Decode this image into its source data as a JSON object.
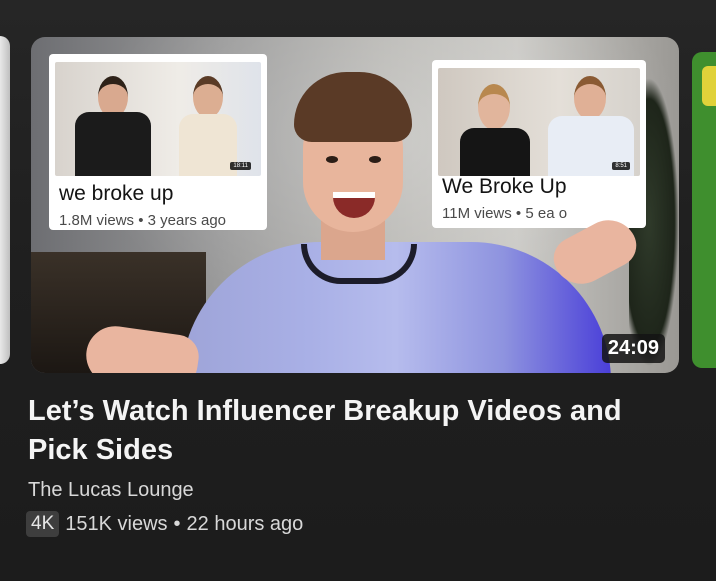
{
  "video": {
    "title": "Let’s Watch Influencer Breakup Videos and Pick Sides",
    "channel": "The Lucas Lounge",
    "quality_badge": "4K",
    "views": "151K views",
    "separator": "•",
    "age": "22 hours ago",
    "duration": "24:09"
  },
  "thumbnail_cards": [
    {
      "title": "we broke up",
      "views": "1.8M views",
      "separator": "•",
      "age": "3 years ago",
      "mini_duration": "18:11"
    },
    {
      "title": "We Broke Up",
      "views": "11M views",
      "separator": "•",
      "age_partial": "5 ea",
      "suffix_partial": "o",
      "mini_duration": "8:51"
    }
  ],
  "colors": {
    "background": "#1f1f1f",
    "title_text": "#f4f4f4",
    "meta_text": "#d8d8d8",
    "badge_bg": "#3e3e3e"
  }
}
